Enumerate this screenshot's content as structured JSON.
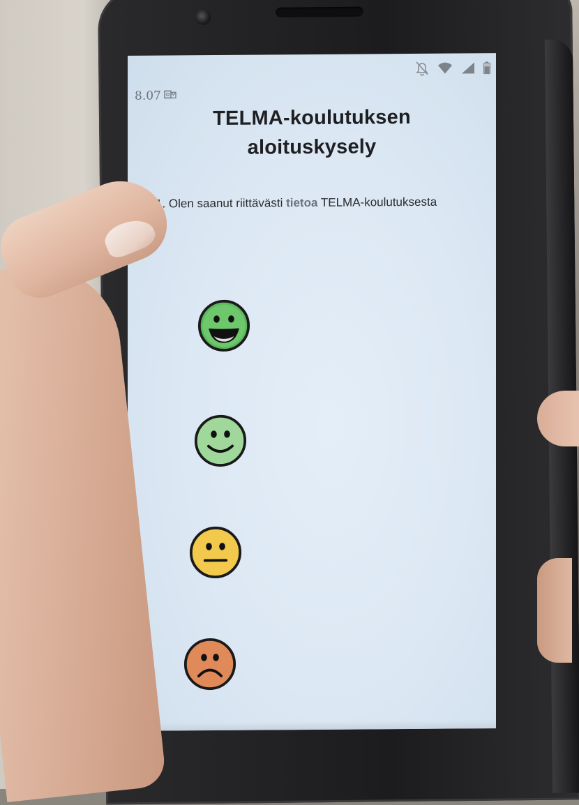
{
  "status_bar": {
    "time": "8.07",
    "notification_icon": "outlook-icon",
    "icons": [
      "bell-off-icon",
      "wifi-icon",
      "signal-icon",
      "battery-icon"
    ]
  },
  "title": {
    "line1": "TELMA-koulutuksen",
    "line2": "aloituskysely"
  },
  "question": {
    "prefix": "1. Olen saanut riittävästi ",
    "highlight": "tietoa",
    "suffix": " TELMA-koulutuksesta"
  },
  "answers": [
    {
      "name": "very-happy-face-icon",
      "color": "#5cb85c"
    },
    {
      "name": "happy-face-icon",
      "color": "#9fd89a"
    },
    {
      "name": "neutral-face-icon",
      "color": "#f2c94c"
    },
    {
      "name": "sad-face-icon",
      "color": "#e08a5a"
    }
  ],
  "colors": {
    "screen_bg": "#dde8f3",
    "text": "#1e1f22",
    "highlight": "#6a7480"
  }
}
